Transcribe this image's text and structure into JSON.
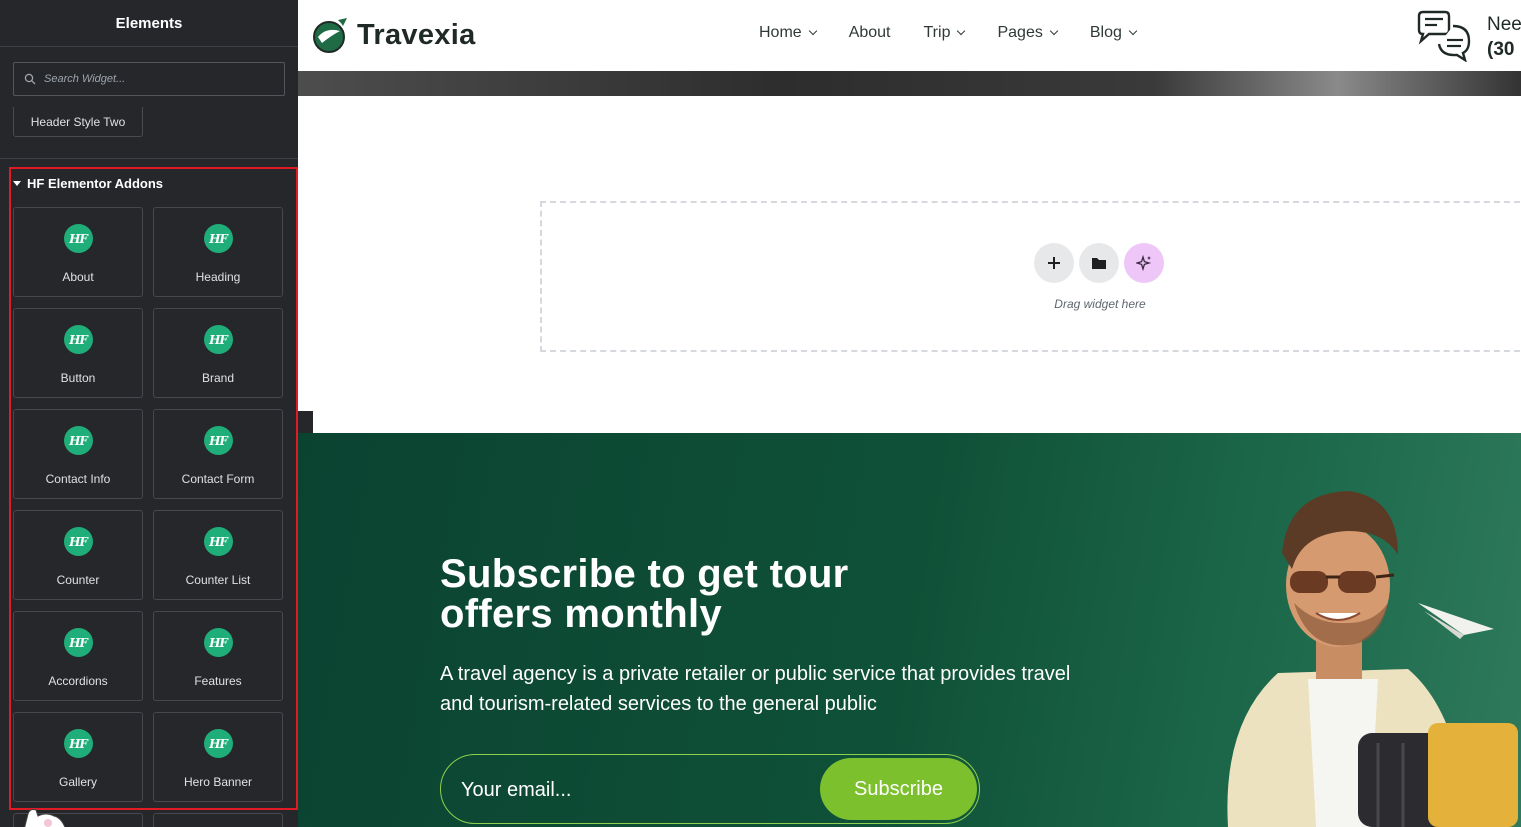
{
  "sidebar": {
    "title": "Elements",
    "search_placeholder": "Search Widget...",
    "previous_widget": "Header Style Two",
    "category_title": "HF Elementor Addons",
    "badge_text": "HF",
    "widgets": [
      "About",
      "Heading",
      "Button",
      "Brand",
      "Contact Info",
      "Contact Form",
      "Counter",
      "Counter List",
      "Accordions",
      "Features",
      "Gallery",
      "Hero Banner"
    ]
  },
  "header": {
    "logo_text": "Travexia",
    "nav": [
      "Home",
      "About",
      "Trip",
      "Pages",
      "Blog"
    ],
    "help_line1": "Nee",
    "help_line2": "(30"
  },
  "dropzone": {
    "hint": "Drag widget here"
  },
  "subscribe": {
    "title_line1": "Subscribe to get tour",
    "title_line2": "offers monthly",
    "description": "A travel agency is a private retailer or public service that provides travel and tourism-related services to the general public",
    "email_placeholder": "Your email...",
    "button_label": "Subscribe"
  },
  "colors": {
    "sidebar_bg": "#26272b",
    "hf_badge": "#1fae79",
    "highlight_border": "#e01b24",
    "section_green": "#0f5138",
    "subscribe_button": "#7cc12d",
    "ai_button": "#eec6f7"
  }
}
